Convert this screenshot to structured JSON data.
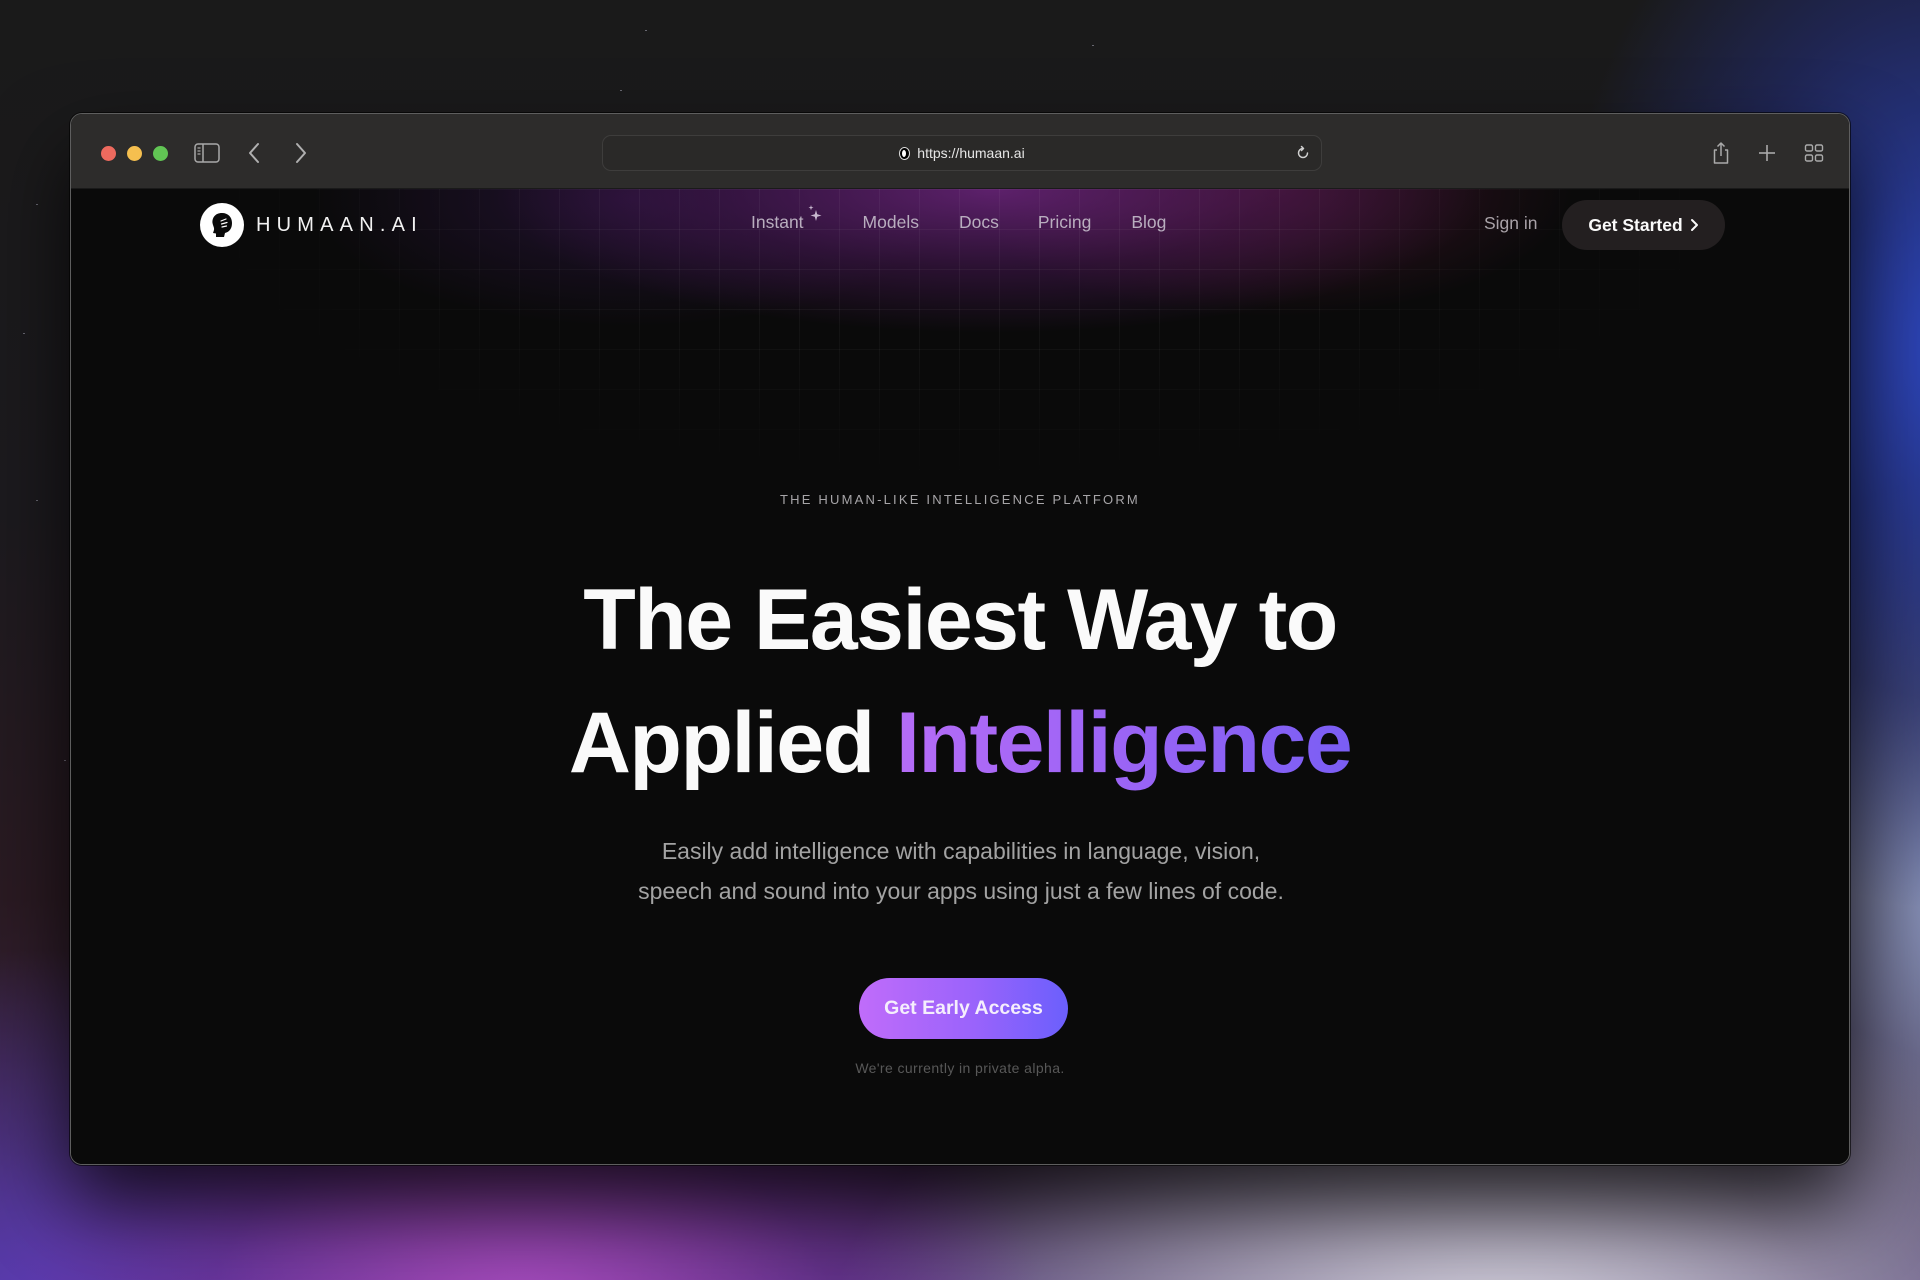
{
  "browser": {
    "url": "https://humaan.ai",
    "toolbar_icons": [
      "sidebar-icon",
      "back-icon",
      "forward-icon",
      "reload-icon",
      "share-icon",
      "new-tab-icon",
      "tab-overview-icon"
    ]
  },
  "site": {
    "logo_text": "HUMAAN.AI",
    "nav": [
      {
        "label": "Instant",
        "badge_icon": "sparkle-icon"
      },
      {
        "label": "Models"
      },
      {
        "label": "Docs"
      },
      {
        "label": "Pricing"
      },
      {
        "label": "Blog"
      }
    ],
    "sign_in_label": "Sign in",
    "get_started_label": "Get Started"
  },
  "hero": {
    "eyebrow": "THE HUMAN-LIKE INTELLIGENCE PLATFORM",
    "headline_line1": "The Easiest Way to",
    "headline_line2_plain": "Applied ",
    "headline_line2_accent": "Intelligence",
    "subtitle": "Easily add intelligence with capabilities in language, vision, speech and sound into your apps using just a few lines of code.",
    "cta_label": "Get Early Access",
    "note": "We're currently in private alpha."
  },
  "colors": {
    "accent_gradient_start": "#c06cfa",
    "accent_gradient_end": "#6b5ffc",
    "page_background": "#0a0a0a",
    "toolbar_background": "#2d2c2b"
  }
}
